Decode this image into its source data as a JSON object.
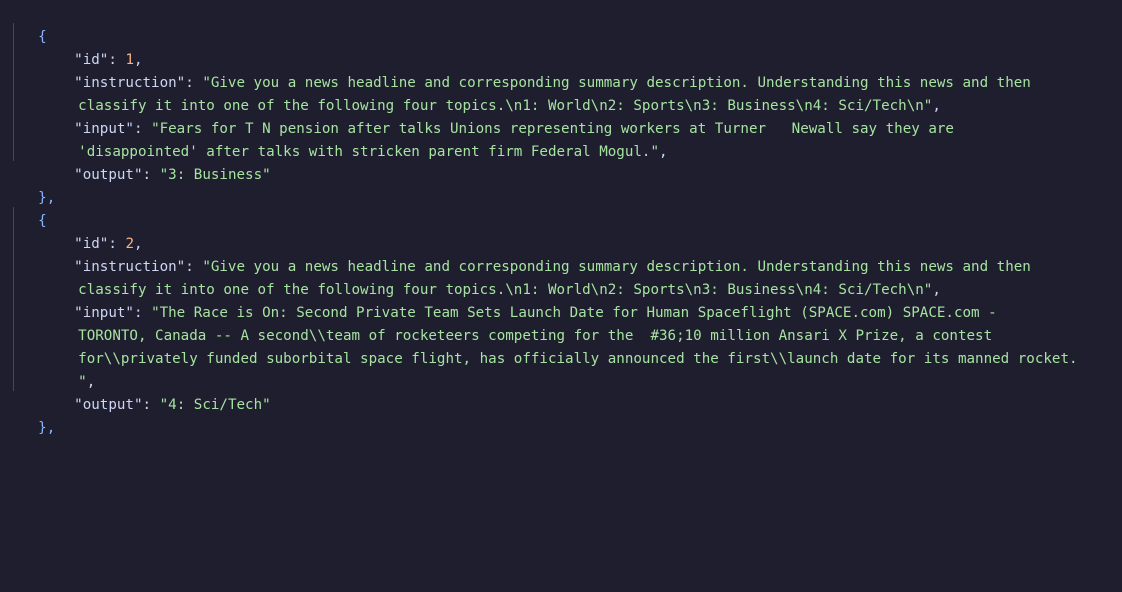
{
  "records": [
    {
      "id_value": "1",
      "instruction_line1": "\"Give you a news headline and corresponding summary description. Understanding this news and then",
      "instruction_line2": "classify it into one of the following four topics.\\n1: World\\n2: Sports\\n3: Business\\n4: Sci/Tech\\n\"",
      "input_line1": "\"Fears for T N pension after talks Unions representing workers at Turner   Newall say they are",
      "input_line2": "'disappointed' after talks with stricken parent firm Federal Mogul.\"",
      "output_value": "\"3: Business\""
    },
    {
      "id_value": "2",
      "instruction_line1": "\"Give you a news headline and corresponding summary description. Understanding this news and then",
      "instruction_line2": "classify it into one of the following four topics.\\n1: World\\n2: Sports\\n3: Business\\n4: Sci/Tech\\n\"",
      "input_line1": "\"The Race is On: Second Private Team Sets Launch Date for Human Spaceflight (SPACE.com) SPACE.com -",
      "input_line2": "TORONTO, Canada -- A second\\\\team of rocketeers competing for the  #36;10 million Ansari X Prize, a contest",
      "input_line3": "for\\\\privately funded suborbital space flight, has officially announced the first\\\\launch date for its manned rocket.",
      "input_line4": "\"",
      "output_value": "\"4: Sci/Tech\""
    }
  ],
  "keys": {
    "id": "\"id\"",
    "instruction": "\"instruction\"",
    "input": "\"input\"",
    "output": "\"output\""
  },
  "syntax": {
    "open_brace": "{",
    "close_brace": "},",
    "colon": ": ",
    "comma": ","
  },
  "colors": {
    "background": "#1e1e2e",
    "brace": "#89b4fa",
    "key": "#cdd6f4",
    "number": "#fab387",
    "string": "#a6e3a1"
  }
}
